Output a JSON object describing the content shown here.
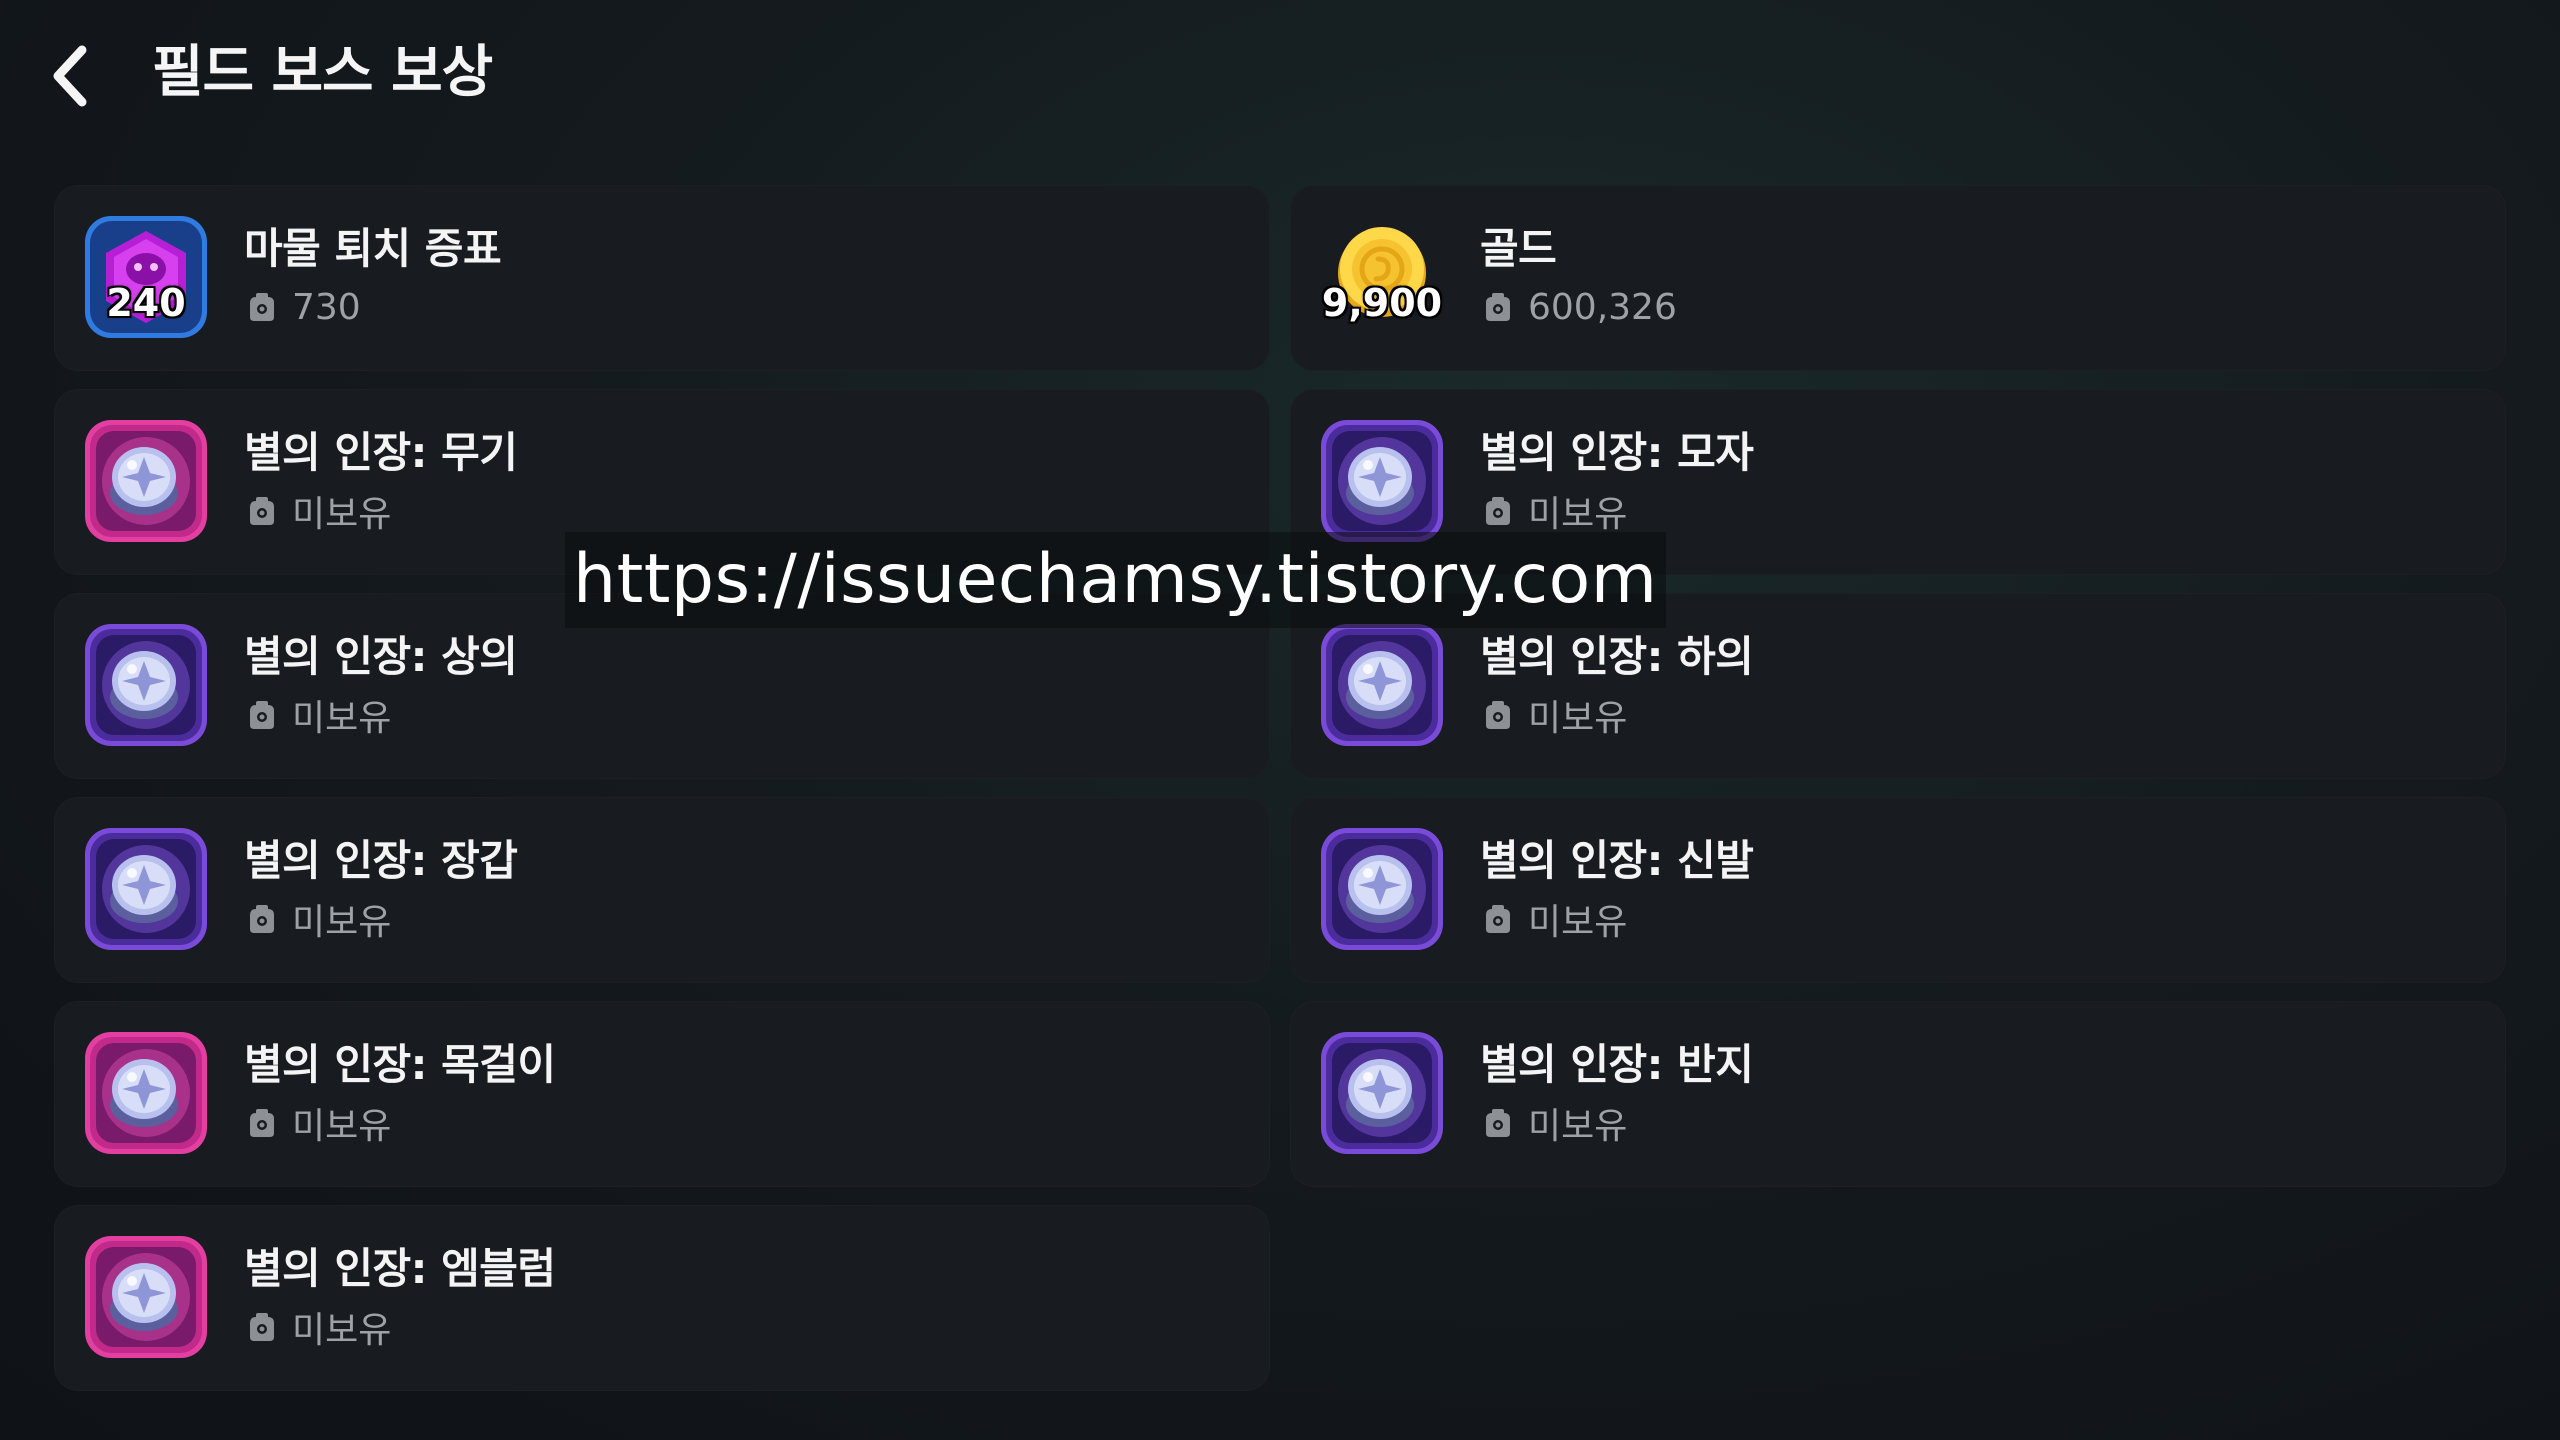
{
  "header": {
    "back_icon": "chevron-left-icon",
    "title": "필드 보스 보상"
  },
  "items": [
    {
      "name": "마물 퇴치 증표",
      "value": "730",
      "qty": "240",
      "icon": "demon-badge-icon",
      "kind": "badge"
    },
    {
      "name": "골드",
      "value": "600,326",
      "qty": "9,900",
      "icon": "gold-coin-icon",
      "kind": "gold"
    },
    {
      "name": "별의 인장: 무기",
      "value": "미보유",
      "qty": "",
      "icon": "star-seal-icon",
      "kind": "seal-pink"
    },
    {
      "name": "별의 인장: 모자",
      "value": "미보유",
      "qty": "",
      "icon": "star-seal-icon",
      "kind": "seal-purple"
    },
    {
      "name": "별의 인장: 상의",
      "value": "미보유",
      "qty": "",
      "icon": "star-seal-icon",
      "kind": "seal-purple"
    },
    {
      "name": "별의 인장: 하의",
      "value": "미보유",
      "qty": "",
      "icon": "star-seal-icon",
      "kind": "seal-purple"
    },
    {
      "name": "별의 인장: 장갑",
      "value": "미보유",
      "qty": "",
      "icon": "star-seal-icon",
      "kind": "seal-purple"
    },
    {
      "name": "별의 인장: 신발",
      "value": "미보유",
      "qty": "",
      "icon": "star-seal-icon",
      "kind": "seal-purple"
    },
    {
      "name": "별의 인장: 목걸이",
      "value": "미보유",
      "qty": "",
      "icon": "star-seal-icon",
      "kind": "seal-pink"
    },
    {
      "name": "별의 인장: 반지",
      "value": "미보유",
      "qty": "",
      "icon": "star-seal-icon",
      "kind": "seal-purple"
    },
    {
      "name": "별의 인장: 엠블럼",
      "value": "미보유",
      "qty": "",
      "icon": "star-seal-icon",
      "kind": "seal-pink"
    }
  ],
  "watermark": "https://issuechamsy.tistory.com",
  "colors": {
    "background": "#141a1e",
    "card": "#181c21",
    "pink_frame": "#e0409c",
    "purple_frame": "#7a4ad8",
    "blue_frame": "#2f7be0",
    "gold": "#f4c542",
    "subtext": "#9ea2a6"
  }
}
